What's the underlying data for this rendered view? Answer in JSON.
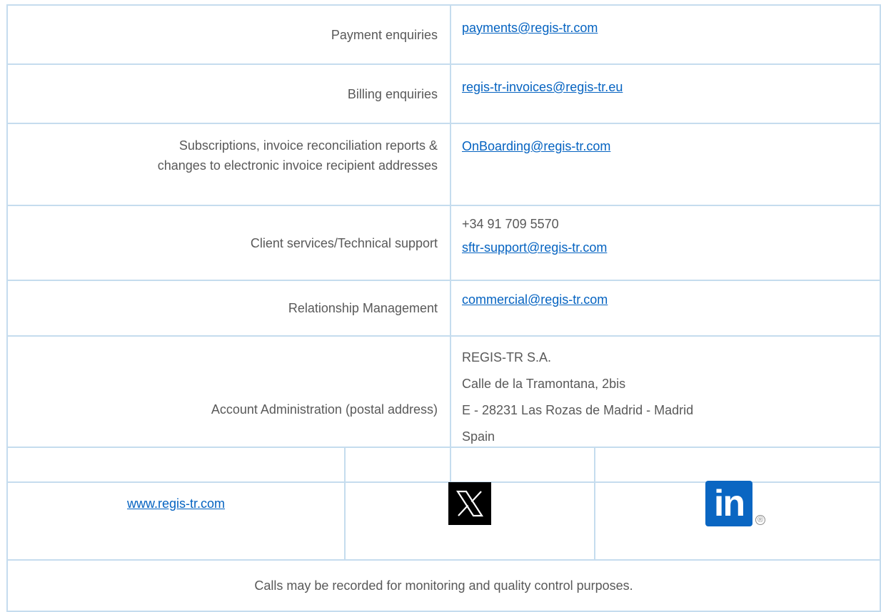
{
  "contacts": [
    {
      "label": "Payment enquiries",
      "values": [
        "payments@regis-tr.com"
      ]
    },
    {
      "label": "Billing enquiries",
      "values": [
        "regis-tr-invoices@regis-tr.eu"
      ]
    },
    {
      "label_lines": [
        "Subscriptions, invoice reconciliation reports &",
        "changes to electronic invoice recipient addresses"
      ],
      "values": [
        "OnBoarding@regis-tr.com"
      ]
    },
    {
      "label": "Client services/Technical support",
      "values": [
        "+34 91 709 5570",
        "sftr-support@regis-tr.com"
      ]
    },
    {
      "label": "Relationship Management",
      "values": [
        "commercial@regis-tr.com"
      ]
    },
    {
      "label": "Account Administration (postal address)",
      "values": [
        "REGIS-TR S.A.",
        "Calle de la Tramontana, 2bis",
        "E - 28231 Las Rozas de Madrid - Madrid",
        "Spain"
      ]
    }
  ],
  "footer": {
    "website": "www.regis-tr.com",
    "x_icon": "x-logo-icon",
    "linkedin_icon": "linkedin-logo-icon",
    "linkedin_text": "in",
    "registered_mark": "®",
    "note": "Calls may be recorded for monitoring and quality control purposes."
  },
  "colors": {
    "border": "#c5dcee",
    "link": "#0563c1",
    "text": "#595959",
    "linkedin": "#0a66c2"
  }
}
